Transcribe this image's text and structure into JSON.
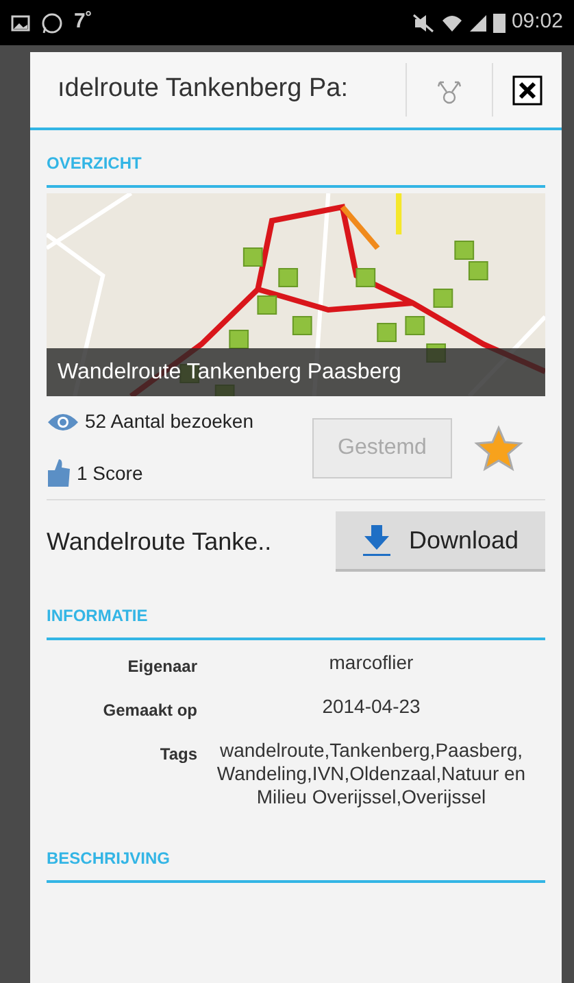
{
  "status_bar": {
    "notification": "7˚",
    "time": "09:02"
  },
  "dialog": {
    "title": "ıdelroute Tankenberg Pa:"
  },
  "overview": {
    "heading": "OVERZICHT",
    "map_caption": "Wandelroute Tankenberg Paasberg",
    "visits": "52 Aantal bezoeken",
    "score": "1 Score",
    "vote_button": {
      "label": "Gestemd",
      "disabled": true
    },
    "favorite": {
      "starred": true
    }
  },
  "download": {
    "name": "Wandelroute Tanke..",
    "button": "Download"
  },
  "information": {
    "heading": "INFORMATIE",
    "rows": [
      {
        "label": "Eigenaar",
        "value": "marcoflier"
      },
      {
        "label": "Gemaakt op",
        "value": "2014-04-23"
      },
      {
        "label": "Tags",
        "value": "wandelroute,Tankenberg,Paasberg, Wandeling,IVN,Oldenzaal,Natuur en Milieu Overijssel,Overijssel"
      }
    ]
  },
  "description": {
    "heading": "BESCHRIJVING"
  }
}
